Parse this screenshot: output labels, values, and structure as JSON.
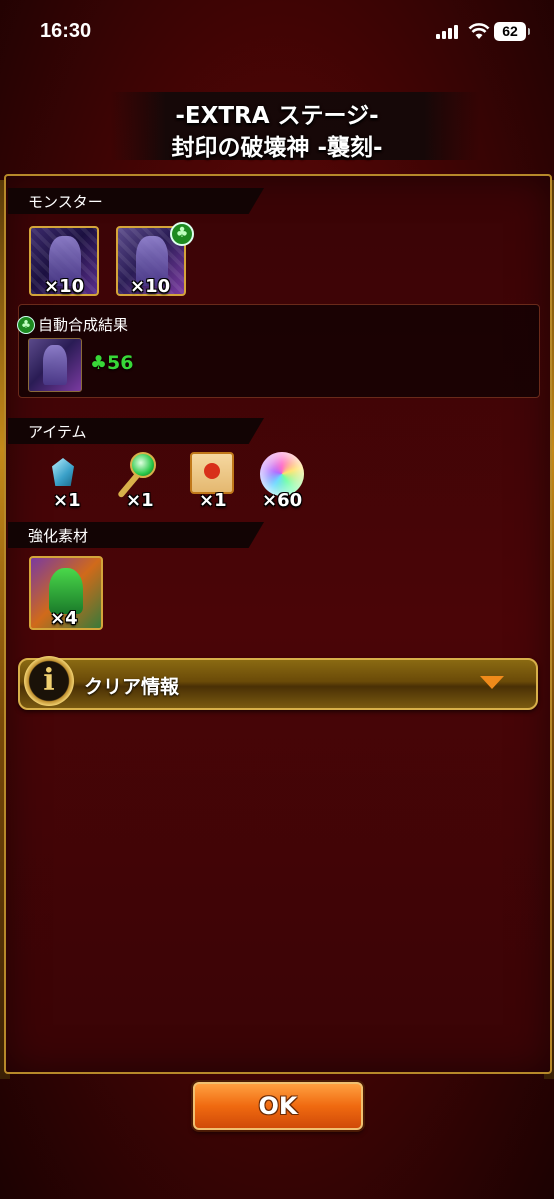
{
  "status": {
    "time": "16:30",
    "battery": "62"
  },
  "title": {
    "line1": "-EXTRA ステージ-",
    "line2": "封印の破壊神 -襲刻-"
  },
  "sections": {
    "monster": {
      "label": "モンスター",
      "cards": [
        {
          "count": "×10"
        },
        {
          "count": "×10",
          "badge": "♣"
        }
      ],
      "fusion": {
        "label": "自動合成結果",
        "icon": "♣",
        "value": "56",
        "value_icon": "♣"
      }
    },
    "items": {
      "label": "アイテム",
      "entries": [
        {
          "name": "gem-icon",
          "count": "×1"
        },
        {
          "name": "staff-icon",
          "count": "×1"
        },
        {
          "name": "scroll-icon",
          "count": "×1"
        },
        {
          "name": "rainbow-orb-icon",
          "count": "×60"
        }
      ]
    },
    "materials": {
      "label": "強化素材",
      "count": "×4"
    }
  },
  "clear_info": {
    "label": "クリア情報"
  },
  "ok_button": {
    "label": "OK"
  },
  "colors": {
    "accent_gold": "#d8b04a",
    "button_orange": "#f06a10",
    "clover_green": "#38d838"
  }
}
